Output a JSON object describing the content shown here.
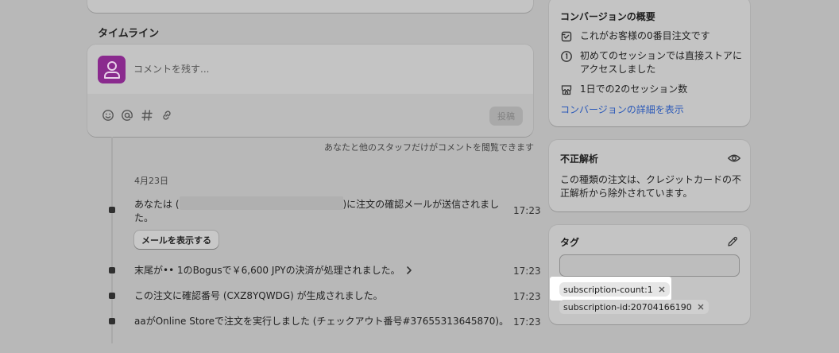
{
  "timeline": {
    "heading": "タイムライン",
    "comment_placeholder": "コメントを残す...",
    "post_label": "投稿",
    "staff_note": "あなたと他のスタッフだけがコメントを閲覧できます",
    "date": "4月23日",
    "events": [
      {
        "text_before": "あなたは (",
        "text_after": ")に注文の確認メールが送信されました。",
        "time": "17:23",
        "button": "メールを表示する"
      },
      {
        "text": "末尾が•• 1のBogusで￥6,600 JPYの決済が処理されました。",
        "time": "17:23"
      },
      {
        "text": "この注文に確認番号 (CXZ8YQWDG) が生成されました。",
        "time": "17:23"
      },
      {
        "text": "aaがOnline Storeで注文を実行しました (チェックアウト番号#37655313645870)。",
        "time": "17:23"
      }
    ]
  },
  "conversion": {
    "title": "コンバージョンの概要",
    "rows": [
      {
        "icon": "order-icon",
        "text": "これがお客様の0番目注文です"
      },
      {
        "icon": "session-icon",
        "text": "初めてのセッションでは直接ストアにアクセスしました"
      },
      {
        "icon": "storefront-icon",
        "text": "1日での2のセッション数"
      }
    ],
    "link": "コンバージョンの詳細を表示"
  },
  "fraud": {
    "title": "不正解析",
    "description": "この種類の注文は、クレジットカードの不正解析から除外されています。"
  },
  "tags": {
    "title": "タグ",
    "input_value": "",
    "items": [
      "subscription-count:1",
      "subscription-id:20704166190"
    ]
  },
  "colors": {
    "avatar": "#8a2a8e",
    "link": "#2b59b8",
    "overlay_gray": "#b8b8b8",
    "highlight": "#ffffff"
  }
}
